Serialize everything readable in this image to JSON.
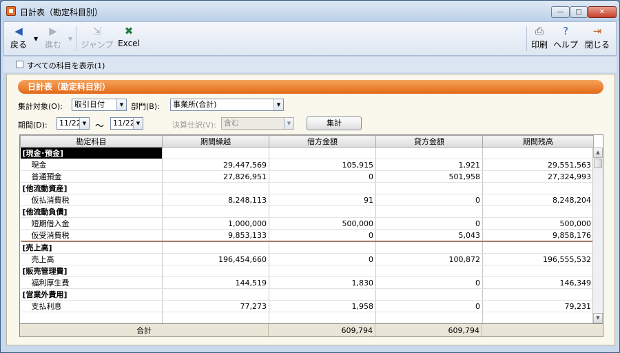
{
  "window": {
    "title": "日計表（勘定科目別）"
  },
  "window_buttons": {
    "minimize": "—",
    "maximize": "□",
    "close": "✕"
  },
  "toolbar": {
    "back": "戻る",
    "forward": "進む",
    "jump": "ジャンプ",
    "excel": "Excel",
    "print": "印刷",
    "help": "ヘルプ",
    "close": "閉じる"
  },
  "options": {
    "show_all_accounts": "すべての科目を表示(1)"
  },
  "panel": {
    "header": "日計表（勘定科目別）"
  },
  "filters": {
    "aggregate_target_label": "集計対象(O):",
    "aggregate_target_value": "取引日付",
    "department_label": "部門(B):",
    "department_value": "事業所(合計)",
    "period_label": "期間(D):",
    "period_from": "11/22",
    "period_sep": "～",
    "period_to": "11/22",
    "settlement_label": "決算仕訳(V):",
    "settlement_value": "含む",
    "aggregate_button": "集計"
  },
  "table": {
    "columns": [
      "勘定科目",
      "期間繰越",
      "借方金額",
      "貸方金額",
      "期間残高"
    ],
    "rows": [
      {
        "name": "[現金･預金]",
        "carry": "",
        "debit": "",
        "credit": "",
        "balance": "",
        "category": true
      },
      {
        "name": "現金",
        "carry": "29,447,569",
        "debit": "105,915",
        "credit": "1,921",
        "balance": "29,551,563"
      },
      {
        "name": "普通預金",
        "carry": "27,826,951",
        "debit": "0",
        "credit": "501,958",
        "balance": "27,324,993"
      },
      {
        "name": "[他流動資産]",
        "carry": "",
        "debit": "",
        "credit": "",
        "balance": "",
        "category": true
      },
      {
        "name": "仮払消費税",
        "carry": "8,248,113",
        "debit": "91",
        "credit": "0",
        "balance": "8,248,204"
      },
      {
        "name": "[他流動負債]",
        "carry": "",
        "debit": "",
        "credit": "",
        "balance": "",
        "category": true
      },
      {
        "name": "短期借入金",
        "carry": "1,000,000",
        "debit": "500,000",
        "credit": "0",
        "balance": "500,000"
      },
      {
        "name": "仮受消費税",
        "carry": "9,853,133",
        "debit": "0",
        "credit": "5,043",
        "balance": "9,858,176"
      },
      {
        "name": "[売上高]",
        "carry": "",
        "debit": "",
        "credit": "",
        "balance": "",
        "category": true
      },
      {
        "name": "売上高",
        "carry": "196,454,660",
        "debit": "0",
        "credit": "100,872",
        "balance": "196,555,532"
      },
      {
        "name": "[販売管理費]",
        "carry": "",
        "debit": "",
        "credit": "",
        "balance": "",
        "category": true
      },
      {
        "name": "福利厚生費",
        "carry": "144,519",
        "debit": "1,830",
        "credit": "0",
        "balance": "146,349"
      },
      {
        "name": "[営業外費用]",
        "carry": "",
        "debit": "",
        "credit": "",
        "balance": "",
        "category": true
      },
      {
        "name": "支払利息",
        "carry": "77,273",
        "debit": "1,958",
        "credit": "0",
        "balance": "79,231"
      },
      {
        "name": "",
        "carry": "",
        "debit": "",
        "credit": "",
        "balance": ""
      }
    ],
    "total": {
      "label": "合計",
      "debit": "609,794",
      "credit": "609,794"
    }
  }
}
